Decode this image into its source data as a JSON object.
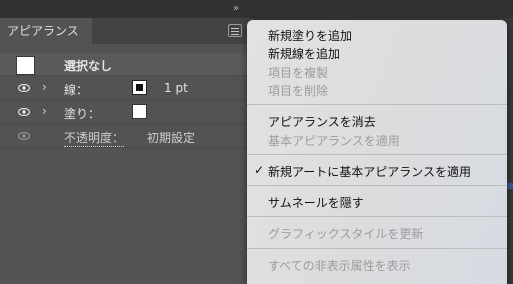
{
  "panel": {
    "collapse_glyph": "»",
    "tab_label": "アピアランス",
    "rows": {
      "selection_label": "選択なし",
      "stroke_label": "線：",
      "stroke_value": "1 pt",
      "fill_label": "塗り：",
      "opacity_label": "不透明度：",
      "opacity_value": "初期設定"
    }
  },
  "menu": {
    "items": [
      {
        "label": "新規塗りを追加",
        "enabled": true
      },
      {
        "label": "新規線を追加",
        "enabled": true
      },
      {
        "label": "項目を複製",
        "enabled": false
      },
      {
        "label": "項目を削除",
        "enabled": false
      },
      {
        "label": "アピアランスを消去",
        "enabled": true
      },
      {
        "label": "基本アピアランスを適用",
        "enabled": false
      },
      {
        "label": "新規アートに基本アピアランスを適用",
        "enabled": true,
        "checked": true
      },
      {
        "label": "サムネールを隠す",
        "enabled": true
      },
      {
        "label": "グラフィックスタイルを更新",
        "enabled": false
      },
      {
        "label": "すべての非表示属性を表示",
        "enabled": false
      }
    ],
    "check_glyph": "✓"
  }
}
